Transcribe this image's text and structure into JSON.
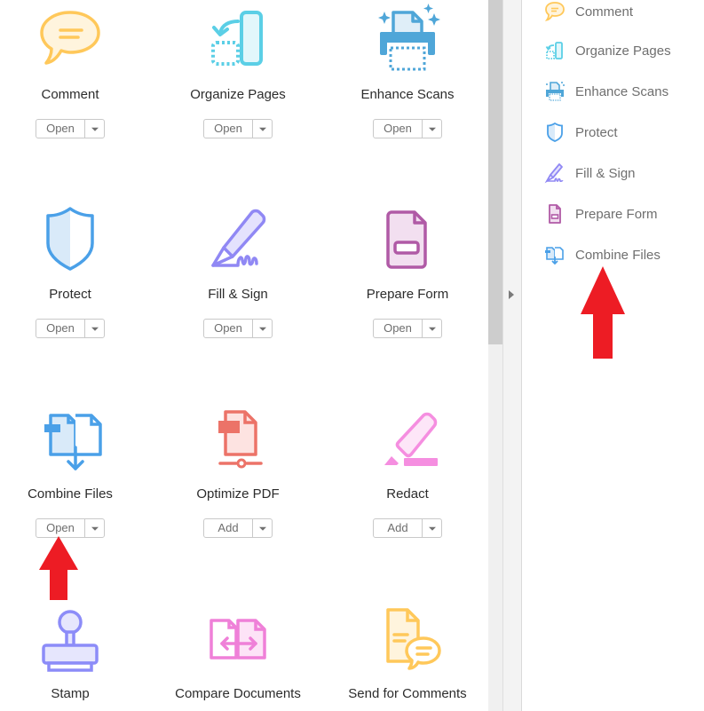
{
  "tools": [
    {
      "id": "comment",
      "name": "Comment",
      "icon": "comment-icon",
      "action": "Open",
      "color": "#ffc85a"
    },
    {
      "id": "organize-pages",
      "name": "Organize Pages",
      "icon": "organize-pages-icon",
      "action": "Open",
      "color": "#5bcfe6"
    },
    {
      "id": "enhance-scans",
      "name": "Enhance Scans",
      "icon": "enhance-scans-icon",
      "action": "Open",
      "color": "#4fa6d8"
    },
    {
      "id": "protect",
      "name": "Protect",
      "icon": "shield-icon",
      "action": "Open",
      "color": "#4aa0e8"
    },
    {
      "id": "fill-sign",
      "name": "Fill & Sign",
      "icon": "pen-sign-icon",
      "action": "Open",
      "color": "#9088f4"
    },
    {
      "id": "prepare-form",
      "name": "Prepare Form",
      "icon": "form-icon",
      "action": "Open",
      "color": "#b05aa6"
    },
    {
      "id": "combine-files",
      "name": "Combine Files",
      "icon": "combine-files-icon",
      "action": "Open",
      "color": "#4aa0e8"
    },
    {
      "id": "optimize-pdf",
      "name": "Optimize PDF",
      "icon": "optimize-pdf-icon",
      "action": "Add",
      "color": "#ec7368"
    },
    {
      "id": "redact",
      "name": "Redact",
      "icon": "redact-marker-icon",
      "action": "Add",
      "color": "#f58ee0"
    },
    {
      "id": "stamp",
      "name": "Stamp",
      "icon": "stamp-icon",
      "color": "#8c8cf8"
    },
    {
      "id": "compare-documents",
      "name": "Compare Documents",
      "icon": "compare-documents-icon",
      "color": "#ef80d8"
    },
    {
      "id": "send-for-comments",
      "name": "Send for Comments",
      "icon": "send-for-comments-icon",
      "color": "#ffc85a"
    }
  ],
  "right_panel": {
    "items": [
      {
        "label": "Comment",
        "icon": "comment-icon"
      },
      {
        "label": "Organize Pages",
        "icon": "organize-pages-icon"
      },
      {
        "label": "Enhance Scans",
        "icon": "enhance-scans-icon"
      },
      {
        "label": "Protect",
        "icon": "shield-icon"
      },
      {
        "label": "Fill & Sign",
        "icon": "pen-sign-icon"
      },
      {
        "label": "Prepare Form",
        "icon": "form-icon"
      },
      {
        "label": "Combine Files",
        "icon": "combine-files-icon"
      }
    ]
  },
  "annotations": {
    "arrow_color": "#ed1c24"
  }
}
